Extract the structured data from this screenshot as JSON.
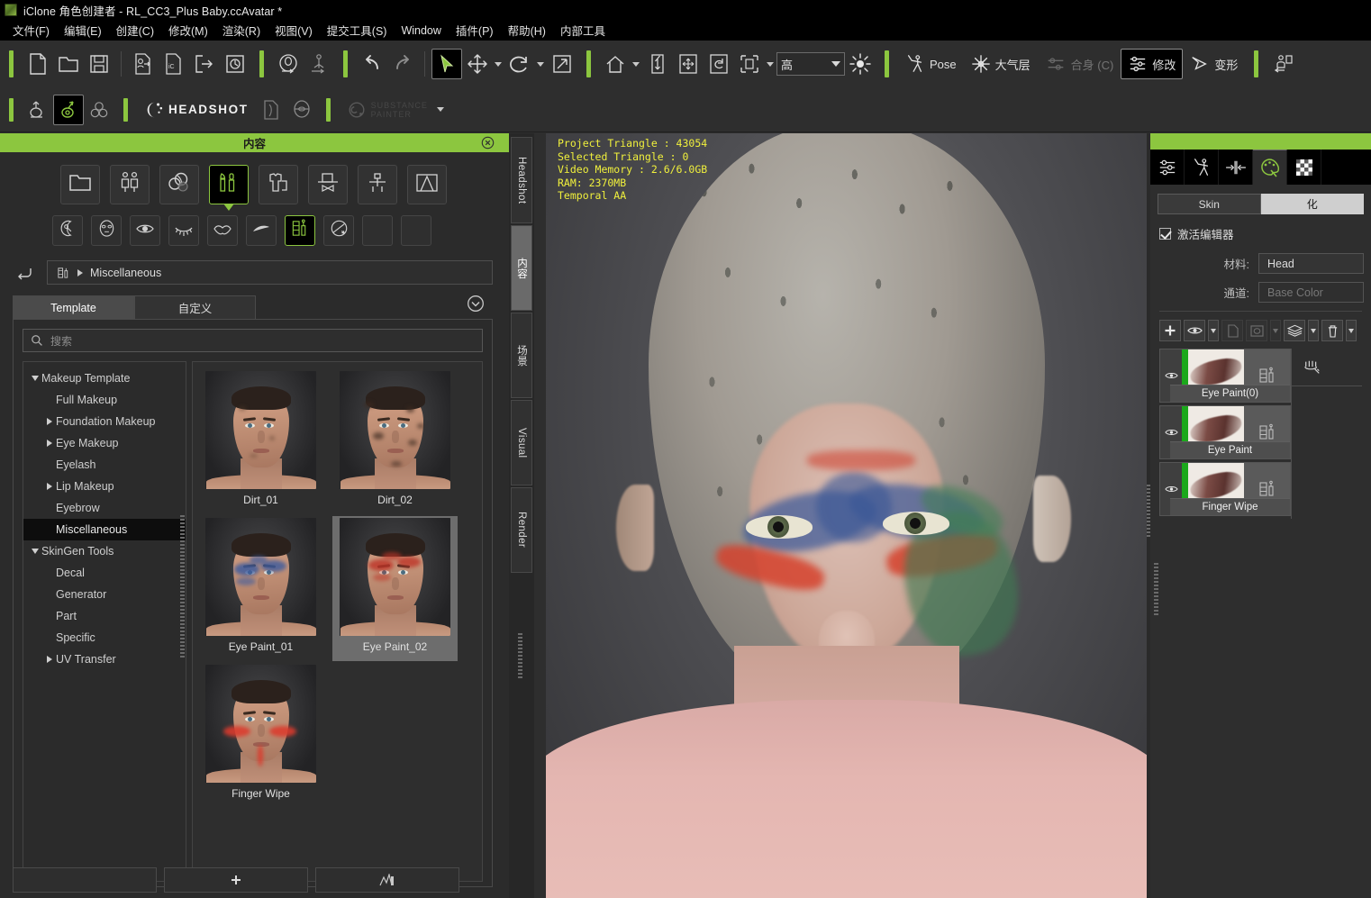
{
  "window": {
    "title": "iClone 角色创建者 - RL_CC3_Plus Baby.ccAvatar *",
    "app_icon": "app-logo-icon"
  },
  "menubar": {
    "items": [
      {
        "label": "文件(F)",
        "name": "menu-file"
      },
      {
        "label": "编辑(E)",
        "name": "menu-edit"
      },
      {
        "label": "创建(C)",
        "name": "menu-create"
      },
      {
        "label": "修改(M)",
        "name": "menu-modify"
      },
      {
        "label": "渲染(R)",
        "name": "menu-render"
      },
      {
        "label": "视图(V)",
        "name": "menu-view"
      },
      {
        "label": "提交工具(S)",
        "name": "menu-submit-tools"
      },
      {
        "label": "Window",
        "name": "menu-window"
      },
      {
        "label": "插件(P)",
        "name": "menu-plugins"
      },
      {
        "label": "帮助(H)",
        "name": "menu-help"
      },
      {
        "label": "内部工具",
        "name": "menu-internal-tools"
      }
    ]
  },
  "toolbar": {
    "quality_combo": {
      "value": "高",
      "name": "render-quality-combo"
    },
    "pose_label": "Pose",
    "atmosphere_label": "大气层",
    "fitting_label": "合身 (C)",
    "modify_label": "修改",
    "morph_label": "变形",
    "headshot_label": "HEADSHOT",
    "substance_line1": "SUBSTANCE",
    "substance_line2": "PAINTER"
  },
  "content_panel": {
    "title": "内容",
    "close_icon": "close-icon",
    "category_row1": [
      {
        "name": "cat-folder",
        "icon": "folder-icon",
        "selected": false
      },
      {
        "name": "cat-avatar",
        "icon": "two-persons-icon",
        "selected": false
      },
      {
        "name": "cat-skin",
        "icon": "palette-spheres-icon",
        "selected": false
      },
      {
        "name": "cat-makeup",
        "icon": "brush-lipstick-icon",
        "selected": true
      },
      {
        "name": "cat-cloth",
        "icon": "shirt-icon",
        "selected": false
      },
      {
        "name": "cat-accessory",
        "icon": "hat-bowtie-icon",
        "selected": false
      },
      {
        "name": "cat-prop",
        "icon": "stick-figure-icon",
        "selected": false
      },
      {
        "name": "cat-scene",
        "icon": "stage-icon",
        "selected": false
      }
    ],
    "category_row2": [
      {
        "name": "sub-head-detail",
        "icon": "head-edit-icon",
        "selected": false
      },
      {
        "name": "sub-face-mask",
        "icon": "face-mask-icon",
        "selected": false
      },
      {
        "name": "sub-eye",
        "icon": "eye-icon",
        "selected": false
      },
      {
        "name": "sub-eyelash",
        "icon": "eyelash-icon",
        "selected": false
      },
      {
        "name": "sub-lip",
        "icon": "lips-icon",
        "selected": false
      },
      {
        "name": "sub-eyebrow",
        "icon": "eyebrow-icon",
        "selected": false
      },
      {
        "name": "sub-misc",
        "icon": "makeup-kit-icon",
        "selected": true
      },
      {
        "name": "sub-skingen",
        "icon": "skingen-icon",
        "selected": false
      },
      {
        "name": "sub-empty-1",
        "icon": "blank-icon",
        "selected": false
      },
      {
        "name": "sub-empty-2",
        "icon": "blank-icon",
        "selected": false
      }
    ],
    "breadcrumb": {
      "back_icon": "back-arrow-icon",
      "folder_icon": "makeup-kit-icon",
      "path": "Miscellaneous"
    },
    "tabs": [
      {
        "label": "Template",
        "name": "tab-template",
        "active": true
      },
      {
        "label": "自定义",
        "name": "tab-custom",
        "active": false
      }
    ],
    "expand_icon": "chevron-down-circle-icon",
    "search": {
      "placeholder": "搜索",
      "value": "",
      "icon": "search-icon"
    },
    "tree": [
      {
        "label": "Makeup Template",
        "level": 1,
        "state": "expanded",
        "selected": false
      },
      {
        "label": "Full Makeup",
        "level": 2,
        "state": "leaf",
        "selected": false
      },
      {
        "label": "Foundation Makeup",
        "level": 2,
        "state": "collapsed",
        "selected": false
      },
      {
        "label": "Eye Makeup",
        "level": 2,
        "state": "collapsed",
        "selected": false
      },
      {
        "label": "Eyelash",
        "level": 2,
        "state": "leaf",
        "selected": false
      },
      {
        "label": "Lip Makeup",
        "level": 2,
        "state": "collapsed",
        "selected": false
      },
      {
        "label": "Eyebrow",
        "level": 2,
        "state": "leaf",
        "selected": false
      },
      {
        "label": "Miscellaneous",
        "level": 2,
        "state": "leaf",
        "selected": true
      },
      {
        "label": "SkinGen Tools",
        "level": 1,
        "state": "expanded",
        "selected": false
      },
      {
        "label": "Decal",
        "level": 2,
        "state": "leaf",
        "selected": false
      },
      {
        "label": "Generator",
        "level": 2,
        "state": "leaf",
        "selected": false
      },
      {
        "label": "Part",
        "level": 2,
        "state": "leaf",
        "selected": false
      },
      {
        "label": "Specific",
        "level": 2,
        "state": "leaf",
        "selected": false
      },
      {
        "label": "UV Transfer",
        "level": 2,
        "state": "collapsed",
        "selected": false
      }
    ],
    "items": [
      {
        "label": "Dirt_01",
        "selected": false,
        "kind": "dirt-light"
      },
      {
        "label": "Dirt_02",
        "selected": false,
        "kind": "dirt-heavy"
      },
      {
        "label": "Eye Paint_01",
        "selected": false,
        "kind": "paint-blue"
      },
      {
        "label": "Eye Paint_02",
        "selected": true,
        "kind": "paint-red"
      },
      {
        "label": "Finger Wipe",
        "selected": false,
        "kind": "wipe-red"
      }
    ]
  },
  "vertical_tabs": [
    {
      "label": "Headshot",
      "name": "vtab-headshot",
      "active": false
    },
    {
      "label": "内容",
      "name": "vtab-content",
      "active": true
    },
    {
      "label": "场景",
      "name": "vtab-scene",
      "active": false
    },
    {
      "label": "Visual",
      "name": "vtab-visual",
      "active": false
    },
    {
      "label": "Render",
      "name": "vtab-render",
      "active": false
    }
  ],
  "viewport": {
    "stats_lines": [
      "Project Triangle : 43054",
      "Selected Triangle : 0",
      "Video Memory : 2.6/6.0GB",
      "RAM: 2370MB",
      "Temporal AA"
    ],
    "stats_color": "#f0f03c"
  },
  "right_panel": {
    "tabs": [
      {
        "name": "rtab-adjust",
        "icon": "sliders-icon",
        "active": false
      },
      {
        "name": "rtab-pose",
        "icon": "pose-figure-icon",
        "active": false
      },
      {
        "name": "rtab-scale",
        "icon": "scale-arrows-icon",
        "active": false
      },
      {
        "name": "rtab-material",
        "icon": "palette-icon",
        "active": true
      },
      {
        "name": "rtab-texture",
        "icon": "checker-icon",
        "active": false
      }
    ],
    "segments": [
      {
        "label": "Skin",
        "name": "seg-skin",
        "active": false
      },
      {
        "label": "化",
        "name": "seg-makeup",
        "active": true
      }
    ],
    "activate_editor": {
      "label": "激活编辑器",
      "checked": true
    },
    "fields": [
      {
        "label": "材料:",
        "value": "Head",
        "name": "material-field",
        "dim": false
      },
      {
        "label": "通道:",
        "value": "Base Color",
        "name": "channel-field",
        "dim": true
      }
    ],
    "layer_tools": [
      {
        "name": "add-layer-button",
        "icon": "plus-icon",
        "caret": false,
        "dim": false
      },
      {
        "name": "visibility-button",
        "icon": "eye-icon",
        "caret": true,
        "dim": false
      },
      {
        "name": "copy-layer-button",
        "icon": "page-icon",
        "caret": false,
        "dim": true
      },
      {
        "name": "mask-button",
        "icon": "mask-icon",
        "caret": true,
        "dim": true
      },
      {
        "name": "merge-layers-button",
        "icon": "stack-icon",
        "caret": true,
        "dim": false
      },
      {
        "name": "delete-layer-button",
        "icon": "trash-icon",
        "caret": true,
        "dim": false
      }
    ],
    "layers": [
      {
        "label": "Eye Paint(0)",
        "visible": true,
        "name": "layer-eye-paint-0"
      },
      {
        "label": "Eye Paint",
        "visible": true,
        "name": "layer-eye-paint"
      },
      {
        "label": "Finger Wipe",
        "visible": true,
        "name": "layer-finger-wipe"
      }
    ],
    "side_icon": "brush-tip-icon"
  },
  "colors": {
    "accent_green": "#8cc63f",
    "panel_bg": "#2e2e2e",
    "dark_bg": "#000000",
    "layer_green": "#1ba81b",
    "stats_yellow": "#f0f03c"
  }
}
